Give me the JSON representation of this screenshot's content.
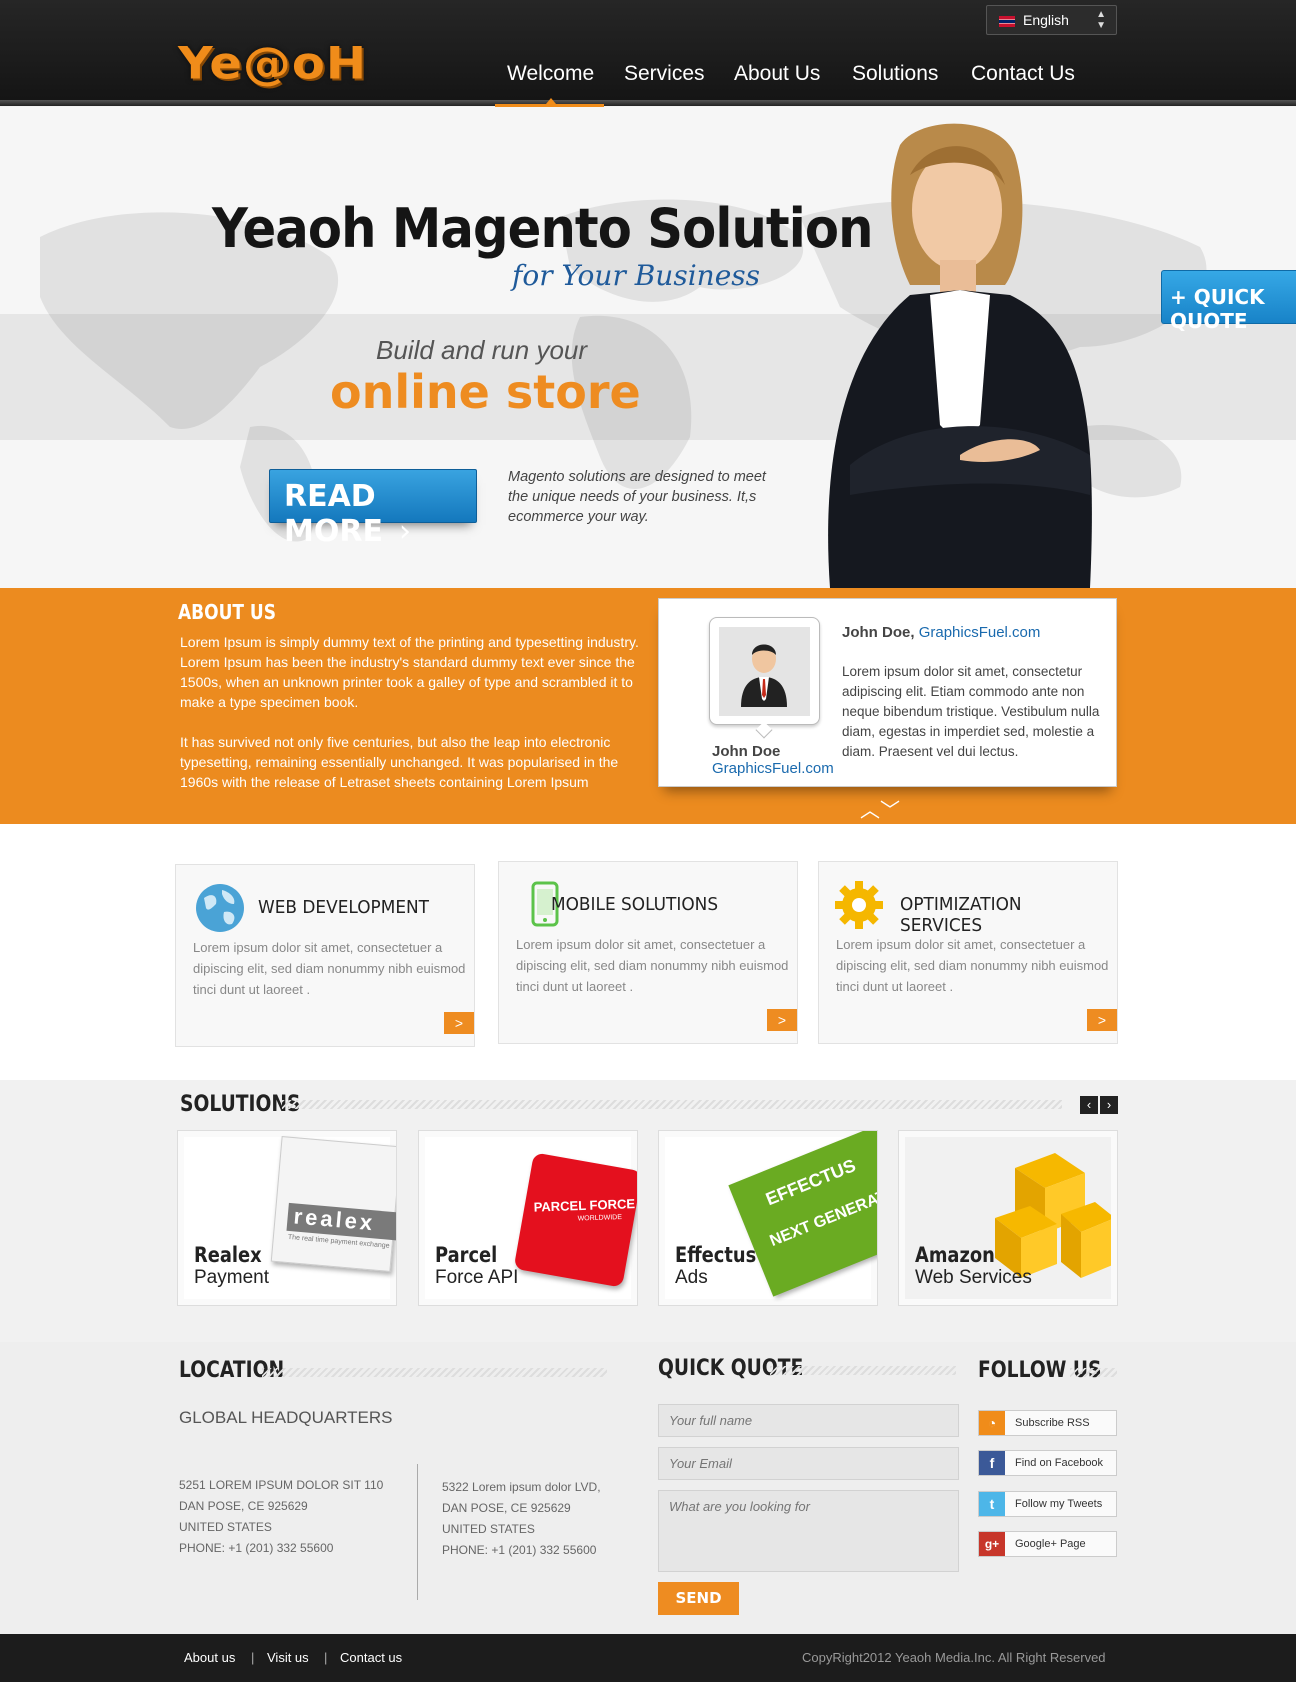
{
  "header": {
    "logo": "Ye@oH",
    "language": "English",
    "nav": [
      "Welcome",
      "Services",
      "About Us",
      "Solutions",
      "Contact Us"
    ],
    "active": "Welcome"
  },
  "hero": {
    "title": "Yeaoh Magento Solution",
    "subtitle": "for Your Business",
    "build": "Build and run your",
    "store": "online store",
    "read_more": "READ MORE",
    "description": "Magento solutions are designed to meet the unique needs of your business. It,s ecommerce your way.",
    "quick_quote": "+ QUICK QUOTE"
  },
  "about": {
    "title": "ABOUT US",
    "p1": "Lorem Ipsum is simply dummy text of the printing and typesetting industry. Lorem Ipsum has been the industry's standard dummy text ever since the 1500s, when an unknown printer took a galley of type and scrambled it to make a type specimen book.",
    "p2": "It has survived not only five centuries, but also the leap into electronic typesetting, remaining essentially unchanged. It was popularised in the 1960s with the release of Letraset sheets containing Lorem Ipsum",
    "testimonial": {
      "name": "John Doe",
      "site": "GraphicsFuel.com",
      "name_comma": "John Doe,",
      "quote": "Lorem ipsum dolor sit amet, consectetur adipiscing elit. Etiam commodo ante non neque bibendum tristique. Vestibulum nulla diam, egestas in imperdiet sed, molestie a diam. Praesent vel dui lectus."
    }
  },
  "services": [
    {
      "title": "WEB DEVELOPMENT",
      "icon": "globe-icon",
      "text": "Lorem ipsum dolor sit amet, consectetuer a dipiscing elit, sed diam nonummy nibh euismod tinci dunt ut laoreet ."
    },
    {
      "title": "MOBILE SOLUTIONS",
      "icon": "mobile-phone-icon",
      "text": "Lorem ipsum dolor sit amet, consectetuer a dipiscing elit, sed diam nonummy nibh euismod tinci dunt ut laoreet ."
    },
    {
      "title": "OPTIMIZATION SERVICES",
      "icon": "gear-icon",
      "text": "Lorem ipsum dolor sit amet, consectetuer a dipiscing elit, sed diam nonummy nibh euismod tinci dunt ut laoreet ."
    }
  ],
  "solutions": {
    "title": "SOLUTIONS",
    "cards": [
      {
        "name": "Realex",
        "sub": "Payment",
        "badge": "realex",
        "tagline": "The real time payment exchange"
      },
      {
        "name": "Parcel",
        "sub": "Force API",
        "badge": "PARCEL FORCE",
        "tagline": "WORLDWIDE"
      },
      {
        "name": "Effectus",
        "sub": "Ads",
        "badge": "EFFECTUS",
        "tagline": "NEXT GENERAT"
      },
      {
        "name": "Amazon",
        "sub": "Web Services"
      }
    ]
  },
  "contact": {
    "location_title": "LOCATION",
    "hq": "GLOBAL HEADQUARTERS",
    "addr1": [
      "5251 LOREM IPSUM DOLOR SIT 110",
      "DAN POSE, CE 925629",
      "UNITED STATES",
      "PHONE: +1 (201) 332 55600"
    ],
    "addr2": [
      "5322 Lorem ipsum dolor LVD,",
      "DAN POSE, CE 925629",
      "UNITED STATES",
      "PHONE: +1 (201) 332 55600"
    ],
    "quote_title": "QUICK QUOTE",
    "name_placeholder": "Your full name",
    "email_placeholder": "Your Email",
    "message_placeholder": "What are you looking for",
    "send": "SEND",
    "follow_title": "FOLLOW US",
    "follow": [
      "Subscribe RSS",
      "Find on Facebook",
      "Follow my Tweets",
      "Google+ Page"
    ]
  },
  "footer": {
    "links": [
      "About us",
      "Visit us",
      "Contact us"
    ],
    "separator": "|",
    "copyright": "CopyRight2012 Yeaoh Media.Inc.  All Right Reserved"
  },
  "colors": {
    "accent": "#ee8c21",
    "blue": "#1a6aae",
    "dark": "#1c1c1c"
  }
}
